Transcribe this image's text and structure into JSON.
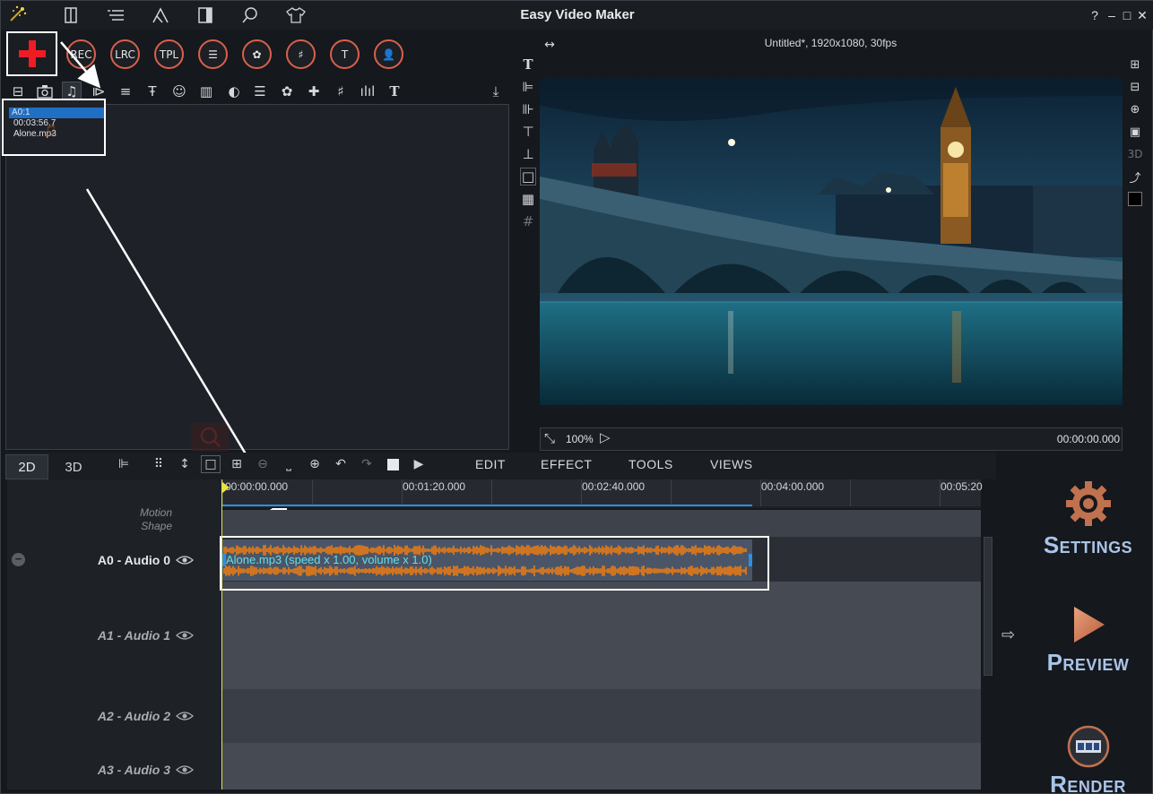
{
  "app": {
    "title": "Easy Video Maker",
    "help": "?",
    "minimize": "–",
    "maximize": "□",
    "close": "✕"
  },
  "topbar_icons": [
    "open-project-icon",
    "menu-list-icon",
    "draw-icon",
    "split-view-icon",
    "search-icon",
    "skin-icon"
  ],
  "toolbar1": {
    "add_label": "+",
    "buttons": [
      {
        "label": "REC"
      },
      {
        "label": "LRC"
      },
      {
        "label": "TPL"
      },
      {
        "label": "☰"
      },
      {
        "label": "✿"
      },
      {
        "label": "♯"
      },
      {
        "label": "T"
      },
      {
        "label": "👤"
      }
    ]
  },
  "media_list": {
    "id": "A0:1",
    "duration": "00:03:56.7",
    "filename": "Alone.mp3"
  },
  "preview": {
    "header": "Untitled*, 1920x1080, 30fps",
    "zoom": "100%",
    "time": "00:00:00.000"
  },
  "timeline": {
    "tab_2d": "2D",
    "tab_3d": "3D",
    "menus": [
      "EDIT",
      "EFFECT",
      "TOOLS",
      "VIEWS"
    ],
    "ruler_labels": [
      "00:00:00.000",
      "00:01:20.000",
      "00:02:40.000",
      "00:04:00.000",
      "00:05:20"
    ],
    "motion_label1": "Motion",
    "motion_label2": "Shape",
    "tracks": [
      {
        "name": "A0 - Audio 0"
      },
      {
        "name": "A1 - Audio 1"
      },
      {
        "name": "A2 - Audio 2"
      },
      {
        "name": "A3 - Audio 3"
      }
    ],
    "clip_label": "Alone.mp3  (speed x 1.00, volume x 1.0)"
  },
  "side": {
    "settings_first": "S",
    "settings_rest": "ETTINGS",
    "preview_first": "P",
    "preview_rest": "REVIEW",
    "render_first": "R",
    "render_rest": "ENDER"
  },
  "colors": {
    "accent_red": "#d8614a",
    "waveform": "#f07d10",
    "clip_text": "#62e0e8",
    "side_label": "#a9c4e8"
  }
}
